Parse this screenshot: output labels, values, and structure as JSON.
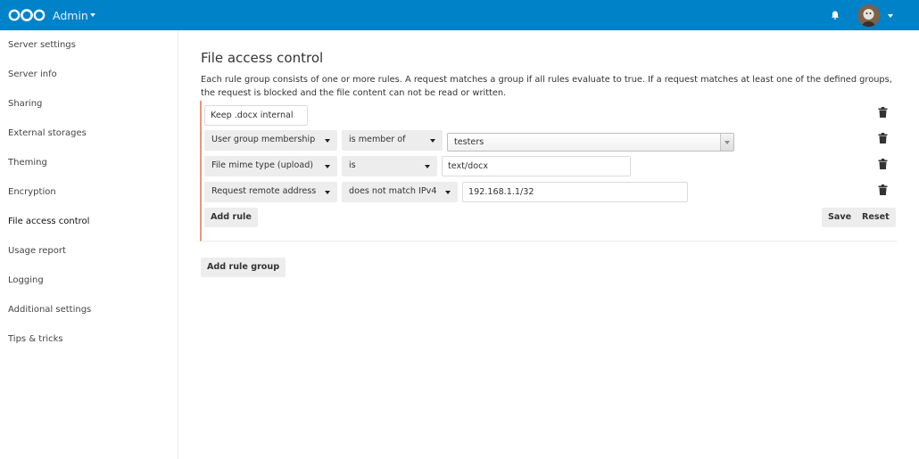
{
  "header": {
    "app_name": "Admin",
    "brand_color": "#0082c9"
  },
  "sidebar": {
    "items": [
      {
        "label": "Server settings"
      },
      {
        "label": "Server info"
      },
      {
        "label": "Sharing"
      },
      {
        "label": "External storages"
      },
      {
        "label": "Theming"
      },
      {
        "label": "Encryption"
      },
      {
        "label": "File access control",
        "active": true
      },
      {
        "label": "Usage report"
      },
      {
        "label": "Logging"
      },
      {
        "label": "Additional settings"
      },
      {
        "label": "Tips & tricks"
      }
    ]
  },
  "main": {
    "title": "File access control",
    "description": "Each rule group consists of one or more rules. A request matches a group if all rules evaluate to true. If a request matches at least one of the defined groups, the request is blocked and the file content can not be read or written.",
    "rule_group": {
      "name_value": "Keep .docx internal",
      "accent_color": "#e9967a",
      "rules": [
        {
          "check": "User group membership",
          "operator": "is member of",
          "value": "testers"
        },
        {
          "check": "File mime type (upload)",
          "operator": "is",
          "value": "text/docx"
        },
        {
          "check": "Request remote address",
          "operator": "does not match IPv4",
          "value": "192.168.1.1/32"
        }
      ],
      "add_rule_label": "Add rule",
      "save_label": "Save",
      "reset_label": "Reset"
    },
    "add_rule_group_label": "Add rule group"
  }
}
